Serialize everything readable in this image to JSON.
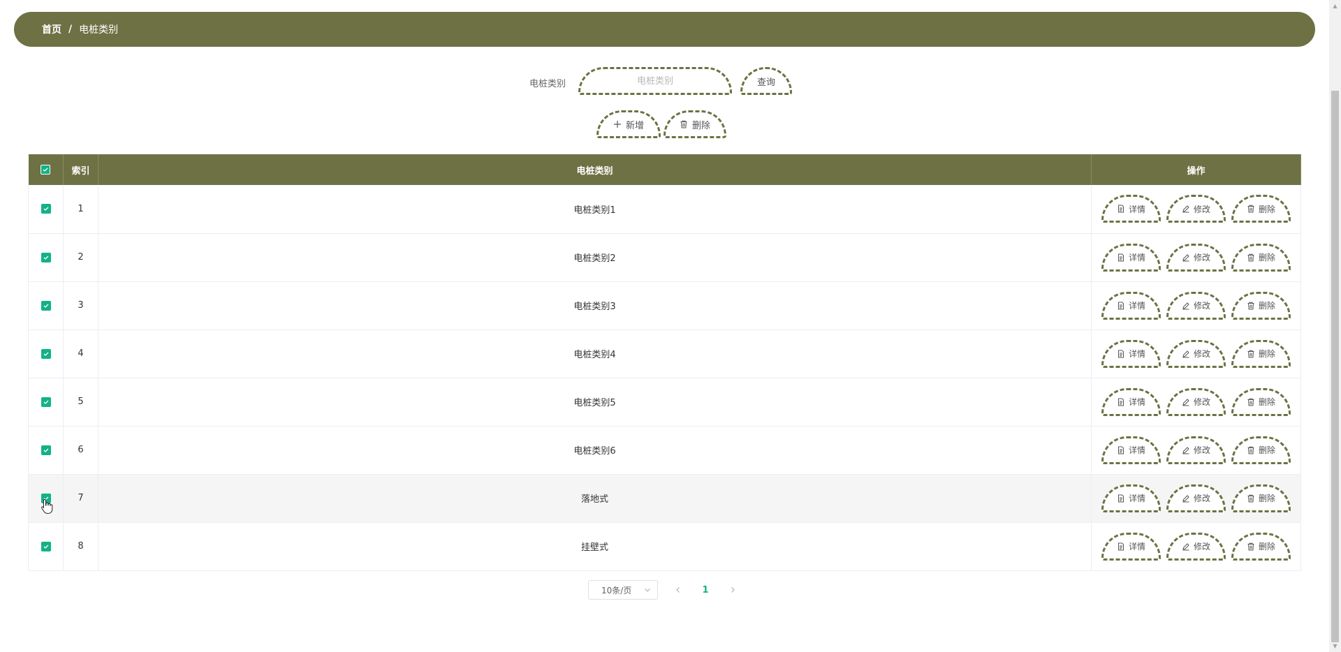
{
  "breadcrumb": {
    "home": "首页",
    "separator": "/",
    "current": "电桩类别"
  },
  "search": {
    "label": "电桩类别",
    "placeholder": "电桩类别",
    "value": "",
    "query_label": "查询"
  },
  "actions": {
    "add_label": "新增",
    "delete_label": "删除"
  },
  "table": {
    "headers": {
      "index": "索引",
      "category": "电桩类别",
      "ops": "操作"
    },
    "rows": [
      {
        "index": "1",
        "category": "电桩类别1",
        "checked": true
      },
      {
        "index": "2",
        "category": "电桩类别2",
        "checked": true
      },
      {
        "index": "3",
        "category": "电桩类别3",
        "checked": true
      },
      {
        "index": "4",
        "category": "电桩类别4",
        "checked": true
      },
      {
        "index": "5",
        "category": "电桩类别5",
        "checked": true
      },
      {
        "index": "6",
        "category": "电桩类别6",
        "checked": true
      },
      {
        "index": "7",
        "category": "落地式",
        "checked": true
      },
      {
        "index": "8",
        "category": "挂壁式",
        "checked": true
      }
    ],
    "row_actions": {
      "detail": "详情",
      "edit": "修改",
      "delete": "删除"
    }
  },
  "pagination": {
    "page_size": "10条/页",
    "current_page": "1"
  },
  "colors": {
    "primary": "#6e7143",
    "checkbox": "#13b286",
    "active_page": "#13b286"
  },
  "icons": {
    "add": "plus-icon",
    "delete": "trash-icon",
    "detail": "document-icon",
    "edit": "pencil-icon",
    "prev": "chevron-left-icon",
    "next": "chevron-right-icon",
    "dropdown": "chevron-down-icon",
    "check": "check-icon"
  }
}
